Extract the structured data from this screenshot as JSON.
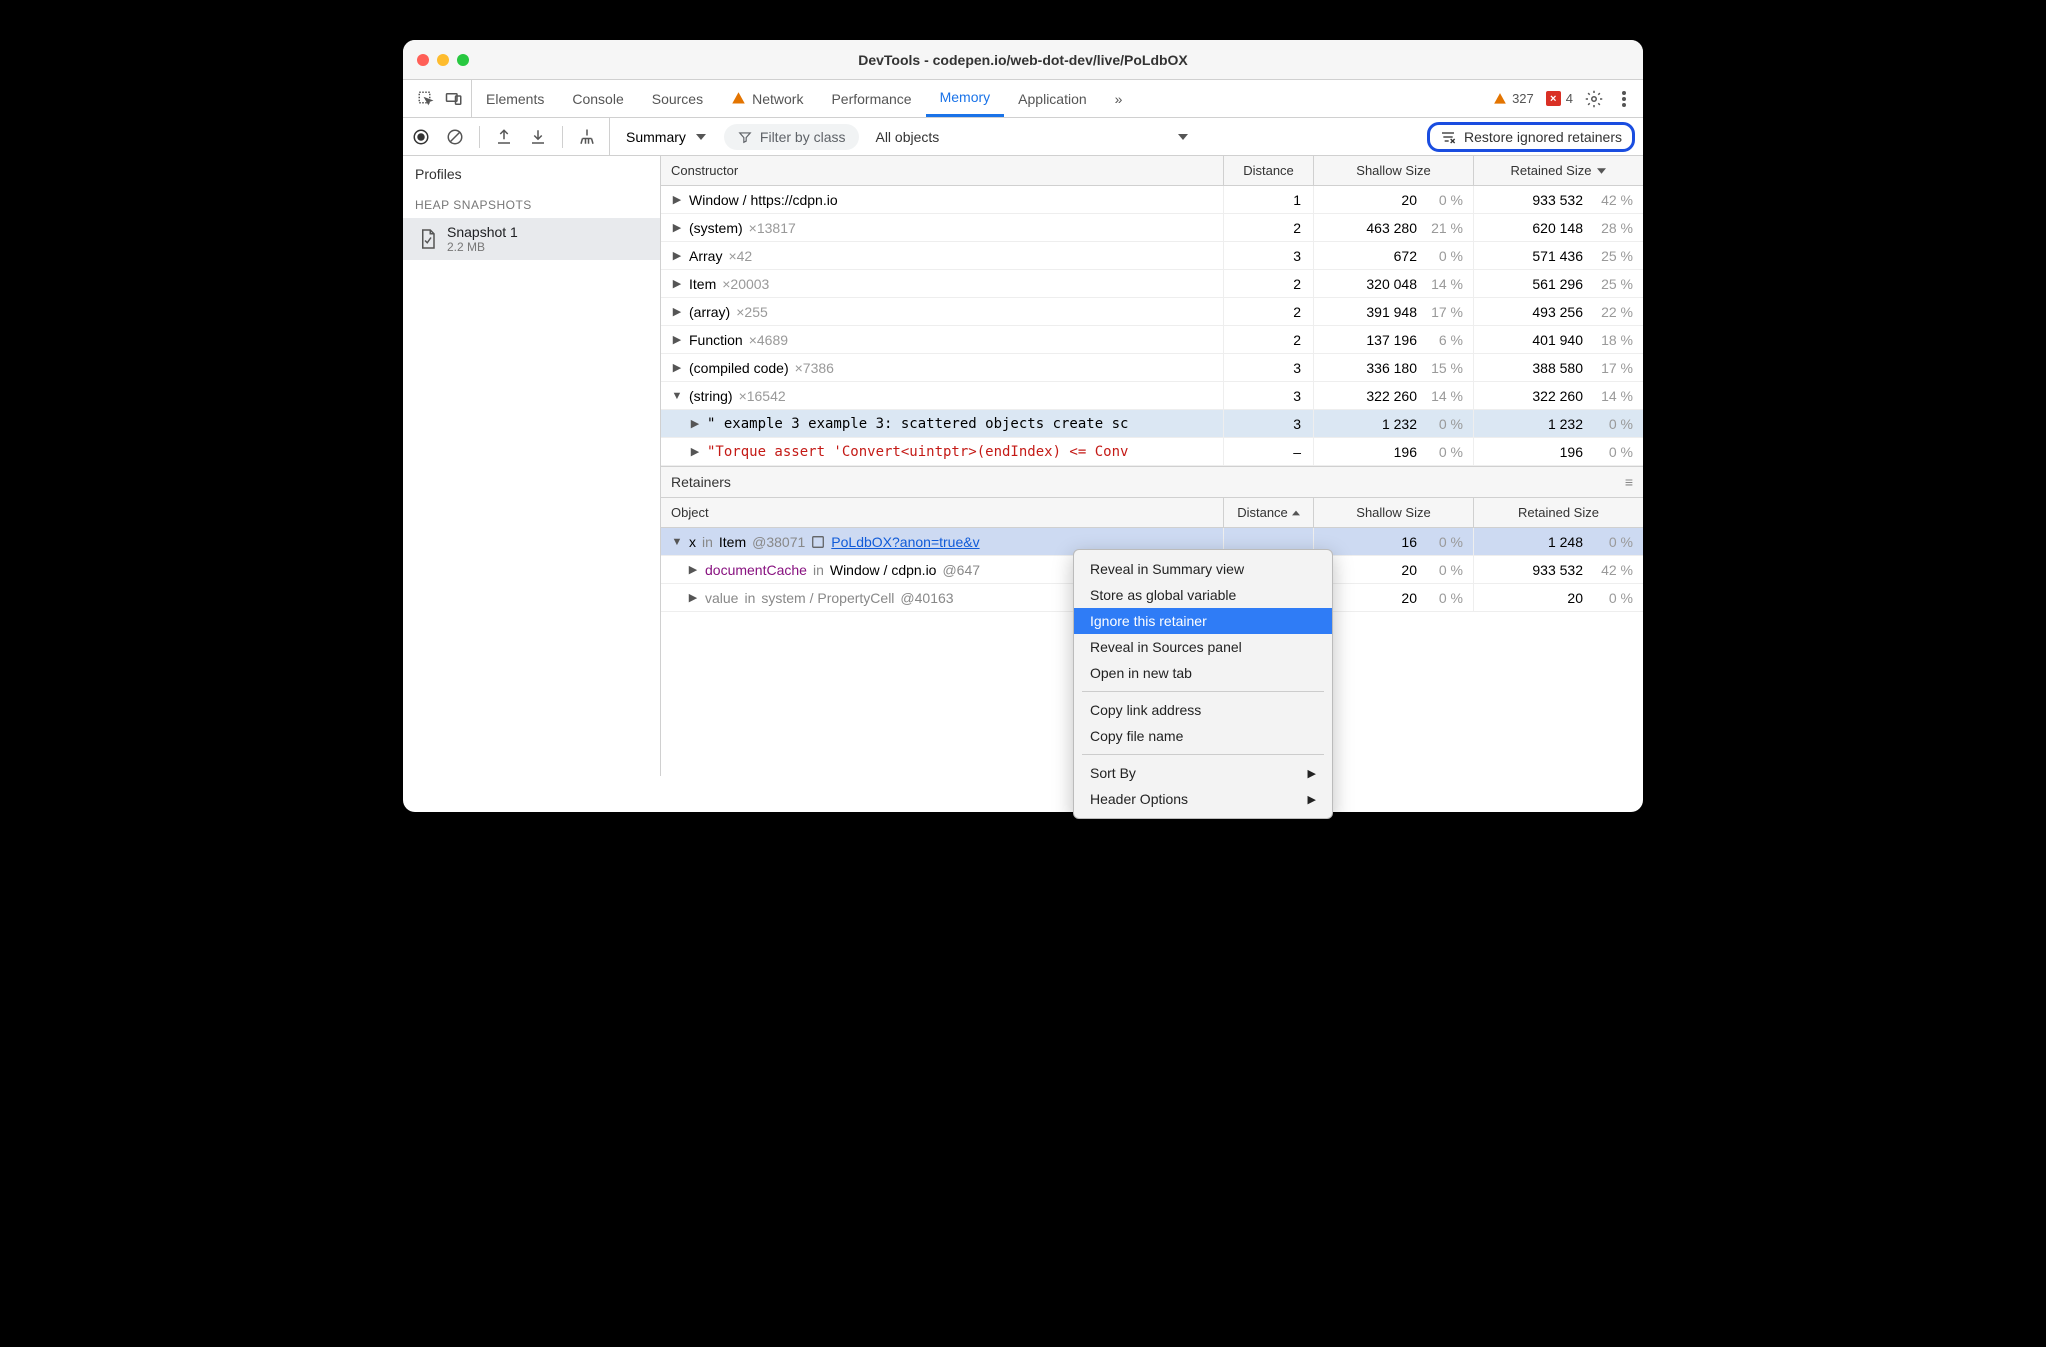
{
  "window": {
    "title": "DevTools - codepen.io/web-dot-dev/live/PoLdbOX"
  },
  "tabs": {
    "items": [
      "Elements",
      "Console",
      "Sources",
      "Network",
      "Performance",
      "Memory",
      "Application"
    ],
    "more": "»",
    "active": "Memory",
    "warn_count": "327",
    "err_count": "4"
  },
  "toolbar": {
    "summary": "Summary",
    "filter_placeholder": "Filter by class",
    "all_objects": "All objects",
    "restore": "Restore ignored retainers"
  },
  "sidebar": {
    "profiles": "Profiles",
    "section": "HEAP SNAPSHOTS",
    "item": {
      "name": "Snapshot 1",
      "size": "2.2 MB"
    }
  },
  "grid": {
    "headers": {
      "constructor": "Constructor",
      "distance": "Distance",
      "shallow": "Shallow Size",
      "retained": "Retained Size"
    },
    "rows": [
      {
        "open": false,
        "label": "Window / https://cdpn.io",
        "x": "",
        "distance": "1",
        "shallow": "20",
        "shallow_pct": "0 %",
        "retained": "933 532",
        "retained_pct": "42 %"
      },
      {
        "open": false,
        "label": "(system)",
        "x": "×13817",
        "distance": "2",
        "shallow": "463 280",
        "shallow_pct": "21 %",
        "retained": "620 148",
        "retained_pct": "28 %"
      },
      {
        "open": false,
        "label": "Array",
        "x": "×42",
        "distance": "3",
        "shallow": "672",
        "shallow_pct": "0 %",
        "retained": "571 436",
        "retained_pct": "25 %"
      },
      {
        "open": false,
        "label": "Item",
        "x": "×20003",
        "distance": "2",
        "shallow": "320 048",
        "shallow_pct": "14 %",
        "retained": "561 296",
        "retained_pct": "25 %"
      },
      {
        "open": false,
        "label": "(array)",
        "x": "×255",
        "distance": "2",
        "shallow": "391 948",
        "shallow_pct": "17 %",
        "retained": "493 256",
        "retained_pct": "22 %"
      },
      {
        "open": false,
        "label": "Function",
        "x": "×4689",
        "distance": "2",
        "shallow": "137 196",
        "shallow_pct": "6 %",
        "retained": "401 940",
        "retained_pct": "18 %"
      },
      {
        "open": false,
        "label": "(compiled code)",
        "x": "×7386",
        "distance": "3",
        "shallow": "336 180",
        "shallow_pct": "15 %",
        "retained": "388 580",
        "retained_pct": "17 %"
      },
      {
        "open": true,
        "label": "(string)",
        "x": "×16542",
        "distance": "3",
        "shallow": "322 260",
        "shallow_pct": "14 %",
        "retained": "322 260",
        "retained_pct": "14 %"
      }
    ],
    "child_row1": {
      "text": "\" example 3 example 3: scattered objects create sc",
      "distance": "3",
      "shallow": "1 232",
      "shallow_pct": "0 %",
      "retained": "1 232",
      "retained_pct": "0 %"
    },
    "child_row2": {
      "text": "\"Torque assert 'Convert<uintptr>(endIndex) <= Conv",
      "distance": "–",
      "shallow": "196",
      "shallow_pct": "0 %",
      "retained": "196",
      "retained_pct": "0 %"
    }
  },
  "retainers": {
    "title": "Retainers",
    "headers": {
      "object": "Object",
      "distance": "Distance",
      "shallow": "Shallow Size",
      "retained": "Retained Size"
    },
    "rows": [
      {
        "open": true,
        "indent": 0,
        "prop": "x",
        "in": "in",
        "obj": "Item",
        "at": "@38071",
        "icon": true,
        "link": "PoLdbOX?anon=true&v",
        "distance": "",
        "shallow": "16",
        "shallow_pct": "0 %",
        "retained": "1 248",
        "retained_pct": "0 %",
        "selected": true
      },
      {
        "open": false,
        "indent": 1,
        "prop": "documentCache",
        "in": "in",
        "obj": "Window / cdpn.io",
        "at": "@647",
        "distance": "",
        "shallow": "20",
        "shallow_pct": "0 %",
        "retained": "933 532",
        "retained_pct": "42 %",
        "purple_prop": true
      },
      {
        "open": false,
        "indent": 1,
        "prop": "value",
        "in": "in",
        "obj": "system / PropertyCell",
        "at": "@40163",
        "distance": "",
        "shallow": "20",
        "shallow_pct": "0 %",
        "retained": "20",
        "retained_pct": "0 %",
        "gray": true
      }
    ]
  },
  "context_menu": {
    "items": [
      {
        "label": "Reveal in Summary view"
      },
      {
        "label": "Store as global variable"
      },
      {
        "label": "Ignore this retainer",
        "highlighted": true
      },
      {
        "label": "Reveal in Sources panel"
      },
      {
        "label": "Open in new tab"
      },
      {
        "sep": true
      },
      {
        "label": "Copy link address"
      },
      {
        "label": "Copy file name"
      },
      {
        "sep": true
      },
      {
        "label": "Sort By",
        "sub": true
      },
      {
        "label": "Header Options",
        "sub": true
      }
    ]
  }
}
